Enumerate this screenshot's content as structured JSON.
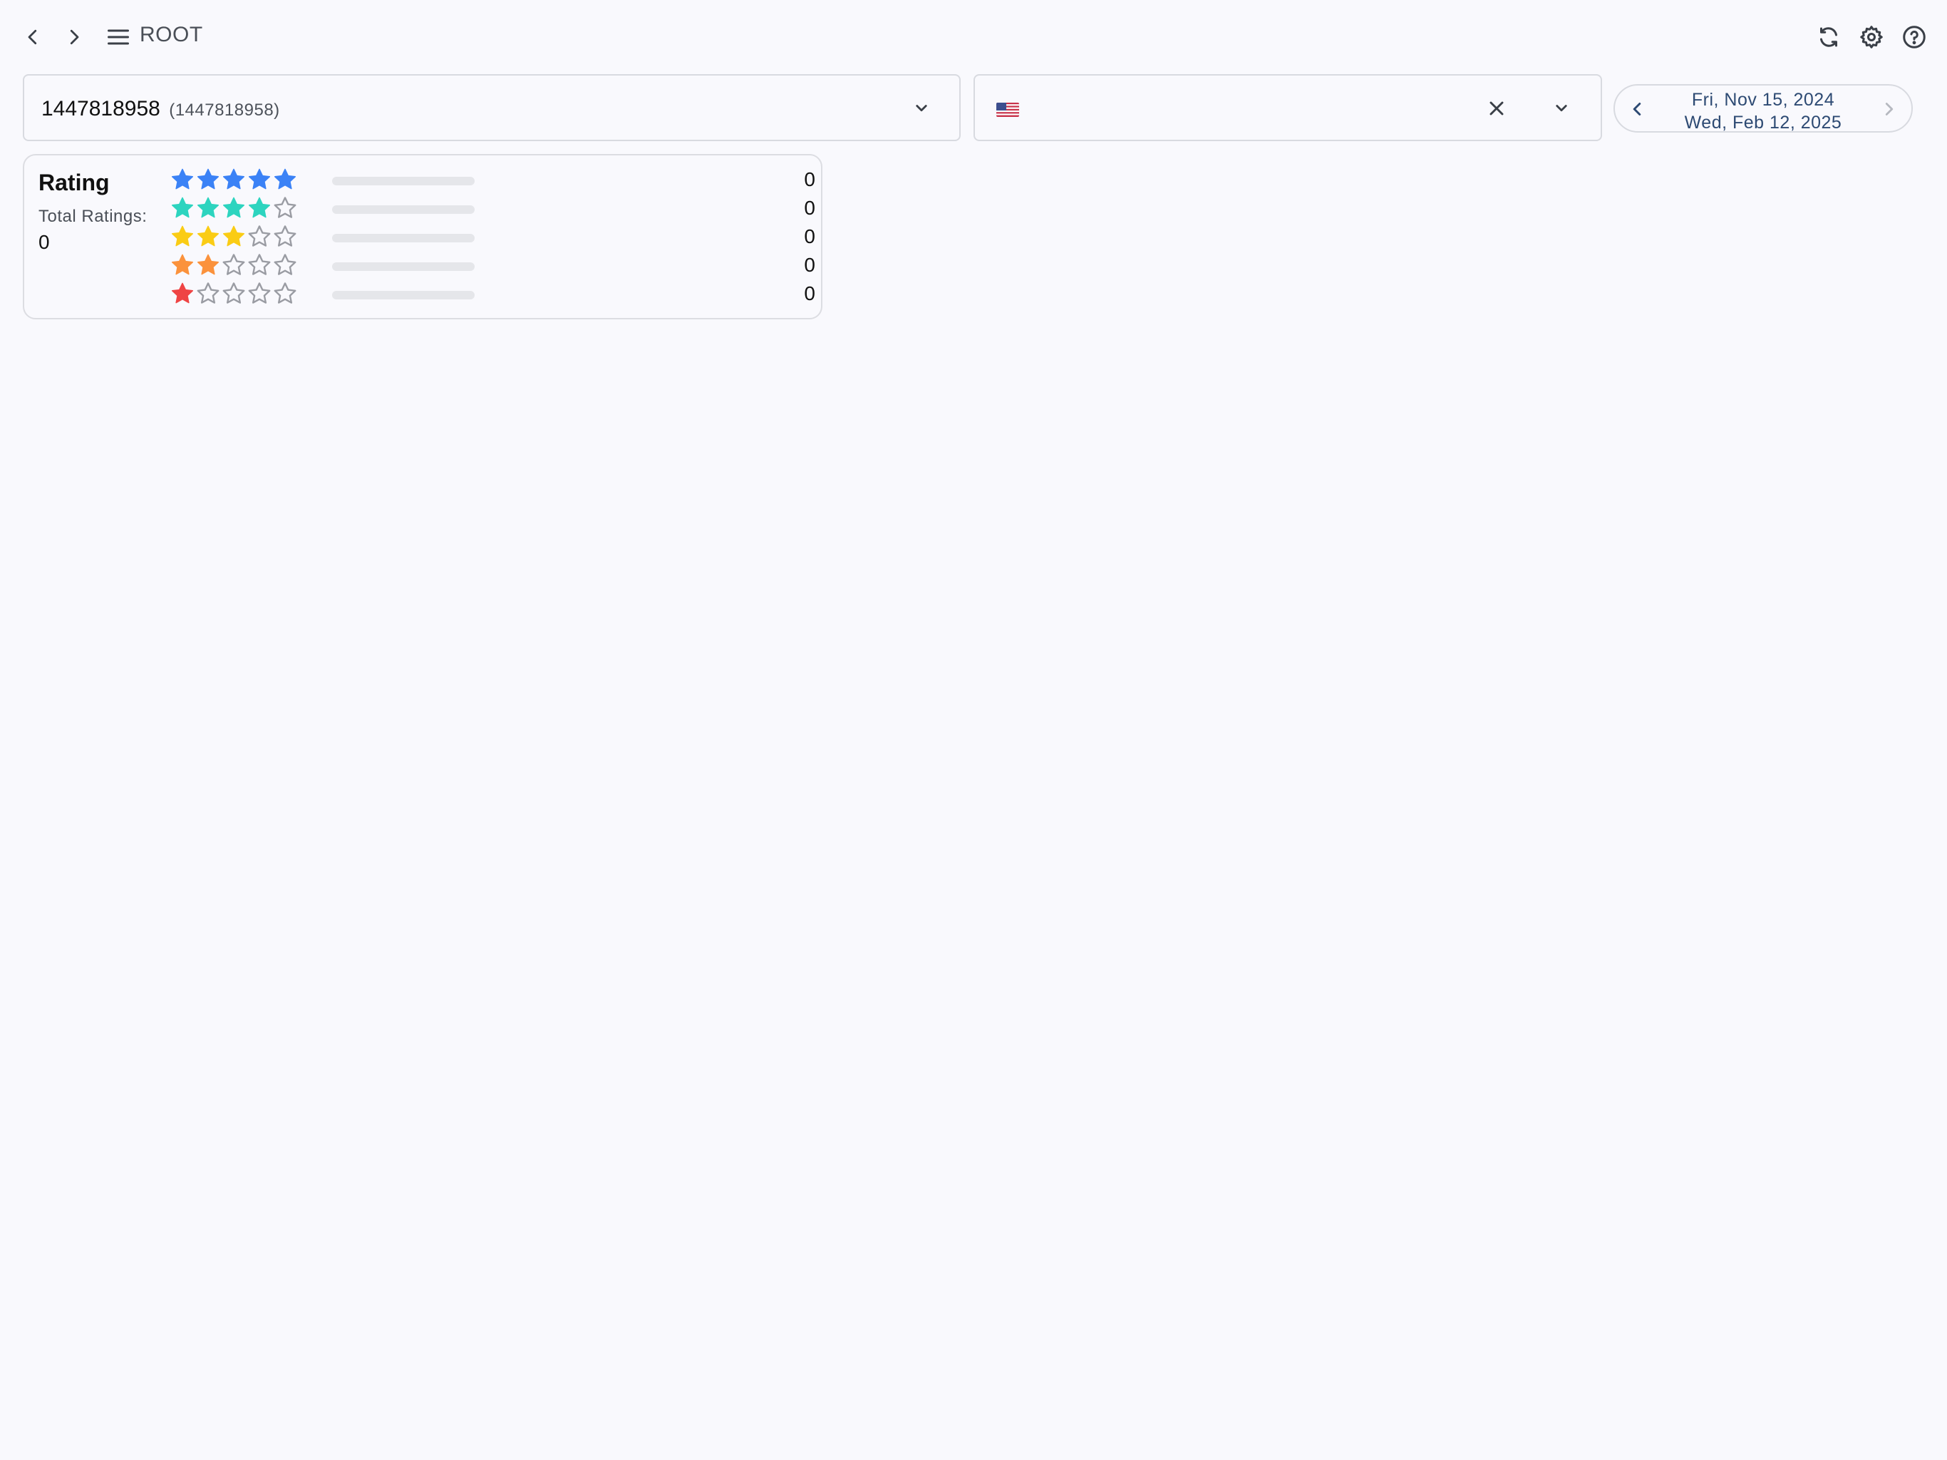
{
  "topbar": {
    "root_label": "ROOT",
    "back_icon": "chevron-left-icon",
    "forward_icon": "chevron-right-icon",
    "menu_icon": "hamburger-menu-icon",
    "refresh_icon": "refresh-icon",
    "settings_icon": "gear-icon",
    "help_icon": "help-circle-icon"
  },
  "app_select": {
    "value": "1447818958",
    "sub_value": "(1447818958)"
  },
  "country_select": {
    "selected_flag": "us-flag-icon"
  },
  "date_range": {
    "start": "Fri, Nov 15, 2024",
    "end": "Wed, Feb 12, 2025"
  },
  "rating": {
    "title": "Rating",
    "total_label": "Total Ratings:",
    "total_value": "0",
    "rows": [
      {
        "stars": 5,
        "color": "#3b82f6",
        "count": "0",
        "fraction": 0
      },
      {
        "stars": 4,
        "color": "#2dd4bf",
        "count": "0",
        "fraction": 0
      },
      {
        "stars": 3,
        "color": "#facc15",
        "count": "0",
        "fraction": 0
      },
      {
        "stars": 2,
        "color": "#fb923c",
        "count": "0",
        "fraction": 0
      },
      {
        "stars": 1,
        "color": "#ef4444",
        "count": "0",
        "fraction": 0
      }
    ]
  },
  "colors": {
    "background": "#f9f9fd",
    "border": "#d8dae0",
    "date_text": "#2d4a73",
    "empty_star": "#9a9ca3",
    "bar_track": "#e5e6ea"
  }
}
